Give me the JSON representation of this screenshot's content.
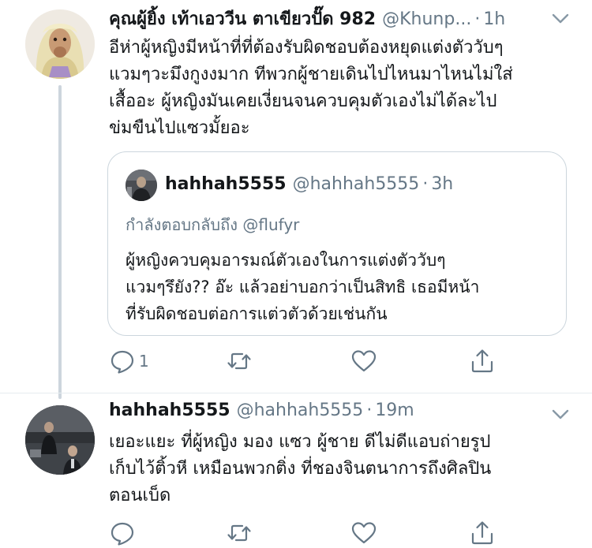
{
  "tweet1": {
    "display_name": "คุณผู้ยิ้ง เท้าเอววีน ตาเขียวปั๊ด 982",
    "handle": "@Khunp...",
    "separator": "·",
    "time": "1h",
    "body_lines": [
      "อีห่าผู้หญิงมีหน้าที่ที่ต้องรับผิดชอบต้องหยุดแต่งตัววับๆ",
      "แวมๆวะมึงกูงงมาก ทีพวกผู้ชายเดินไปไหนมาไหนไม่ใส่",
      "เสื้ออะ ผู้หญิงมันเคยเงี่ยนจนควบคุมตัวเองไม่ได้ละไป",
      "ข่มขืนไปแซวมั้ยอะ"
    ],
    "quoted": {
      "display_name": "hahhah5555",
      "handle": "@hahhah5555",
      "separator": "·",
      "time": "3h",
      "reply_to_label": "กำลังตอบกลับถึง",
      "reply_to_handle": "@flufyr",
      "body_lines": [
        "ผู้หญิงควบคุมอารมณ์ตัวเองในการแต่งตัววับๆ",
        "แวมๆรึยัง?? อ๊ะ แล้วอย่าบอกว่าเป็นสิทธิ เธอมีหน้า",
        "ที่รับผิดชอบต่อการแต่วตัวด้วยเช่นกัน"
      ]
    },
    "reply_count": "1"
  },
  "tweet2": {
    "display_name": "hahhah5555",
    "handle": "@hahhah5555",
    "separator": "·",
    "time": "19m",
    "body_lines": [
      "เยอะแยะ ที่ผู้หญิง มอง แซว ผู้ชาย ดีไม่ดีแอบถ่ายรูป",
      "เก็บไว้ติ้วหี เหมือนพวกติ่ง ที่ชองจินตนาการถึงศิลปิน",
      "ตอนเบ็ด"
    ]
  },
  "icons": {
    "reply": "reply-icon",
    "retweet": "retweet-icon",
    "like": "like-icon",
    "share": "share-icon",
    "menu": "chevron-down-icon"
  },
  "colors": {
    "text": "#14171a",
    "secondary": "#657786",
    "border": "#ccd6dd",
    "thread_line": "#cdd5dd"
  }
}
